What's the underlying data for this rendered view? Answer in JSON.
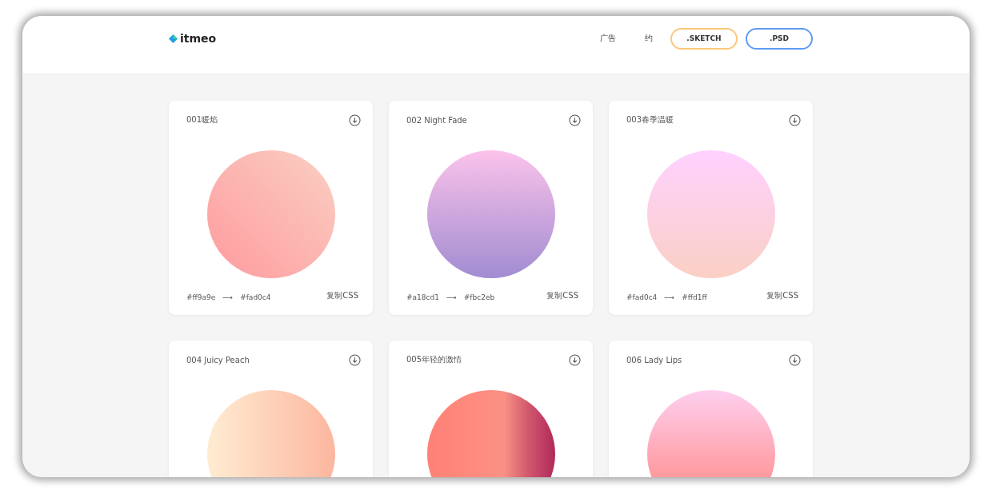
{
  "header": {
    "logo": "itmeo",
    "nav": [
      "广告",
      "约"
    ],
    "buttons": [
      {
        "label": ".SKETCH",
        "color": "#fcc779"
      },
      {
        "label": ".PSD",
        "color": "#5e9cf3"
      }
    ]
  },
  "cards": [
    {
      "title": "001暖焰",
      "kind": "diagonal",
      "from": "#ff9a9e",
      "arrow": "⟶",
      "to": "#fad0c4",
      "action": "复制CSS"
    },
    {
      "title": "002 Night Fade",
      "kind": "vertical",
      "from": "#a18cd1",
      "arrow": "⟶",
      "to": "#fbc2eb",
      "action": "复制CSS"
    },
    {
      "title": "003春季温暖",
      "kind": "vertical",
      "from": "#fad0c4",
      "arrow": "⟶",
      "to": "#ffd1ff",
      "action": "复制CSS"
    },
    {
      "title": "004 Juicy Peach",
      "kind": "horizontal",
      "stops": [
        {
          "color": "#ffecd2"
        },
        {
          "color": "#fcb69f"
        }
      ]
    },
    {
      "title": "005年轻的激情",
      "kind": "horizontal",
      "stops": [
        {
          "color": "#ff8177"
        },
        {
          "color": "#ff867a"
        },
        {
          "color": "#ff8c7f"
        },
        {
          "color": "#f99185"
        },
        {
          "color": "#cf556c"
        },
        {
          "color": "#b12a5b"
        }
      ]
    },
    {
      "title": "006 Lady Lips",
      "kind": "vertical",
      "stops": [
        {
          "color": "#ff9a9e"
        },
        {
          "color": "#fecfef"
        }
      ]
    }
  ]
}
